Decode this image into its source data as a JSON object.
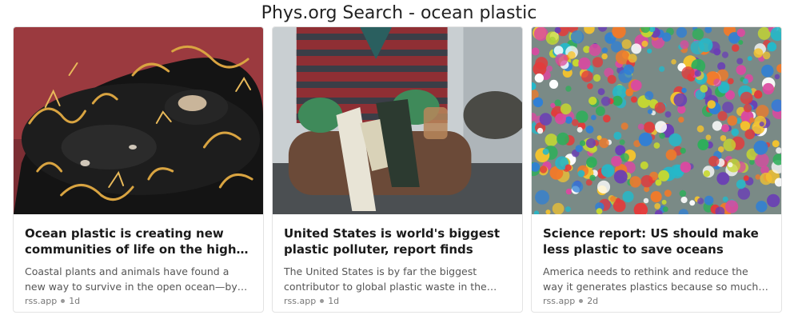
{
  "page": {
    "title": "Phys.org Search - ocean plastic"
  },
  "cards": [
    {
      "image": "seaweed-covered-debris-with-crab",
      "title": "Ocean plastic is creating new communities of life on the high…",
      "description": "Coastal plants and animals have found a new way to survive in the open ocean—by…",
      "source": "rss.app",
      "age": "1d"
    },
    {
      "image": "person-holding-plastic-waste",
      "title": "United States is world's biggest plastic polluter, report finds",
      "description": "The United States is by far the biggest contributor to global plastic waste in the worl…",
      "source": "rss.app",
      "age": "1d"
    },
    {
      "image": "colorful-plastic-bottle-caps",
      "title": "Science report: US should make less plastic to save oceans",
      "description": "America needs to rethink and reduce the way it generates plastics because so much of the…",
      "source": "rss.app",
      "age": "2d"
    }
  ],
  "colors": {
    "card_border": "#e3e3e3",
    "title_text": "#1a1a1a",
    "desc_text": "#555555",
    "meta_text": "#777777"
  }
}
